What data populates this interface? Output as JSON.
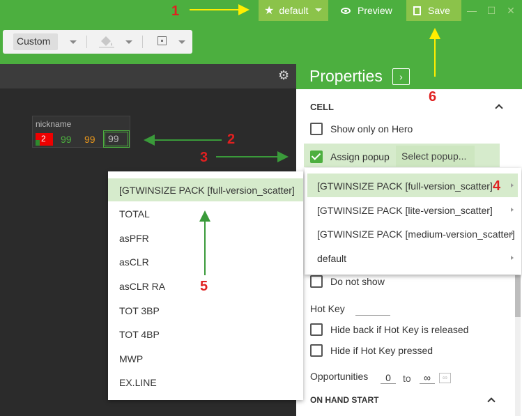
{
  "titlebar": {
    "profile_label": "default",
    "preview_label": "Preview",
    "save_label": "Save"
  },
  "toolbar": {
    "mode_value": "Custom"
  },
  "hud": {
    "name": "nickname",
    "seat": "2",
    "value1": "99",
    "value2": "99",
    "value3": "99"
  },
  "properties": {
    "title": "Properties",
    "section_cell": "CELL",
    "show_only_on_hero": "Show only on Hero",
    "assign_popup": "Assign popup",
    "select_popup": "Select popup...",
    "do_not_show": "Do not show",
    "hot_key": "Hot Key",
    "hide_back": "Hide back if Hot Key is released",
    "hide_if_pressed": "Hide if Hot Key pressed",
    "opportunities": "Opportunities",
    "opp_from": "0",
    "opp_to_label": "to",
    "opp_to": "∞",
    "section_on_hand_start": "ON HAND START"
  },
  "popup_menu": {
    "items": [
      {
        "label": "[GTWINSIZE PACK [full-version_scatter]"
      },
      {
        "label": "[GTWINSIZE PACK [lite-version_scatter]"
      },
      {
        "label": "[GTWINSIZE PACK [medium-version_scatter]"
      },
      {
        "label": "default"
      }
    ]
  },
  "stat_menu": {
    "items": [
      {
        "label": "[GTWINSIZE PACK [full-version_scatter]"
      },
      {
        "label": "TOTAL"
      },
      {
        "label": "asPFR"
      },
      {
        "label": "asCLR"
      },
      {
        "label": "asCLR RA"
      },
      {
        "label": "TOT 3BP"
      },
      {
        "label": "TOT 4BP"
      },
      {
        "label": "MWP"
      },
      {
        "label": "EX.LINE"
      }
    ]
  },
  "annotations": {
    "n1": "1",
    "n2": "2",
    "n3": "3",
    "n4": "4",
    "n5": "5",
    "n6": "6"
  },
  "colors": {
    "brand_green": "#4caf3f",
    "light_green": "#8bc34a",
    "highlight": "#d6ebcc",
    "annotation_red": "#e02020",
    "arrow_yellow": "#ffee00",
    "arrow_green": "#3a9a3a"
  }
}
